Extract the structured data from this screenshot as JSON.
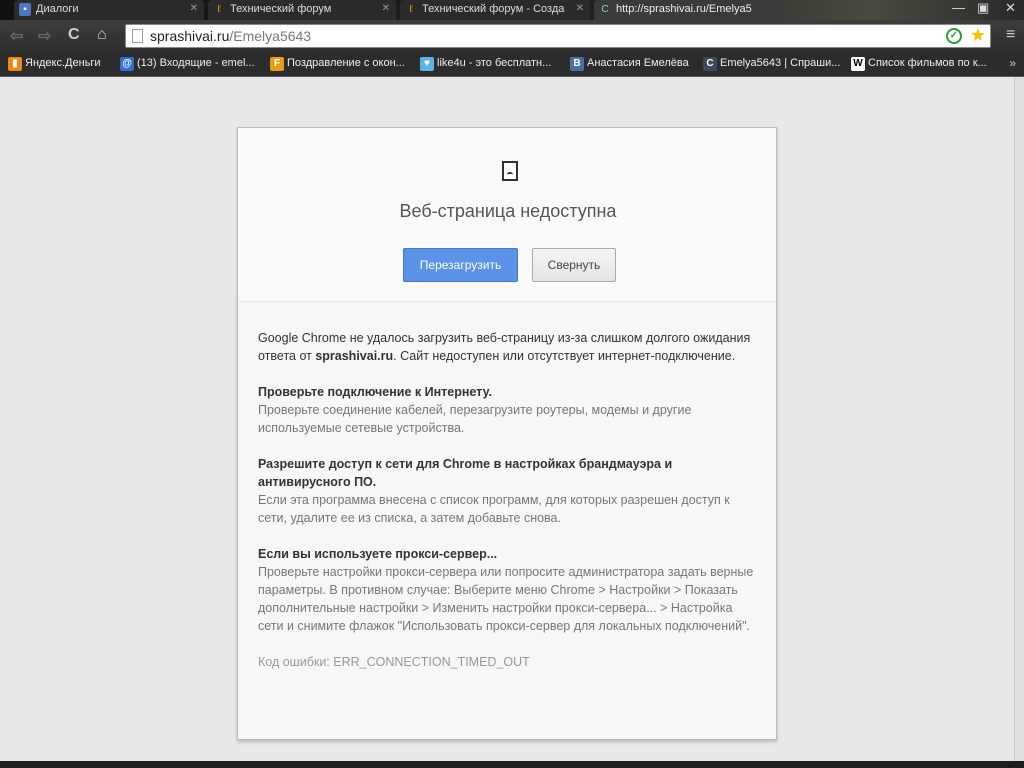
{
  "tabs": [
    {
      "title": "Диалоги",
      "icon": "dialog-icon",
      "active": false
    },
    {
      "title": "Технический форум",
      "icon": "forum-icon",
      "active": false
    },
    {
      "title": "Технический форум - Созда",
      "icon": "forum-icon",
      "active": false
    },
    {
      "title": "http://sprashivai.ru/Emelya5",
      "icon": "sprashivai-icon",
      "active": true
    }
  ],
  "omnibox": {
    "host": "sprashivai.ru",
    "path": "/Emelya5643"
  },
  "bookmarks": [
    {
      "label": "Яндекс.Деньги",
      "icon": "yandex-money-icon",
      "color": "#f0870f",
      "glyph": "▮"
    },
    {
      "label": "(13) Входящие - emel...",
      "icon": "mail-icon",
      "color": "#2a6ed6",
      "glyph": "@"
    },
    {
      "label": "Поздравление с окон...",
      "icon": "for-icon",
      "color": "#e89b14",
      "glyph": "F"
    },
    {
      "label": "like4u - это бесплатн...",
      "icon": "heart-icon",
      "color": "#5ab4e6",
      "glyph": "♥"
    },
    {
      "label": "Анастасия Емелёва",
      "icon": "vk-icon",
      "color": "#4a6fa5",
      "glyph": "B"
    },
    {
      "label": "Emelya5643 | Спраши...",
      "icon": "sprashivai-icon",
      "color": "#3a4a5a",
      "glyph": "C"
    },
    {
      "label": "Список фильмов по к...",
      "icon": "wikipedia-icon",
      "color": "#ffffff",
      "glyph": "W"
    }
  ],
  "error": {
    "title": "Веб-страница недоступна",
    "reload_label": "Перезагрузить",
    "hide_label": "Свернуть",
    "summary_pre": "Google Chrome не удалось загрузить веб-страницу из-за слишком долгого ожидания ответа от ",
    "summary_host": "sprashivai.ru",
    "summary_post": ". Сайт недоступен или отсутствует интернет-подключение.",
    "sections": [
      {
        "heading": "Проверьте подключение к Интернету.",
        "text": "Проверьте соединение кабелей, перезагрузите роутеры, модемы и другие используемые сетевые устройства."
      },
      {
        "heading": "Разрешите доступ к сети для Chrome в настройках брандмауэра и антивирусного ПО.",
        "text": "Если эта программа внесена с список программ, для которых разрешен доступ к сети, удалите ее из списка, а затем добавьте снова."
      },
      {
        "heading": "Если вы используете прокси-сервер...",
        "text": "Проверьте настройки прокси-сервера или попросите администратора задать верные параметры. В противном случае: Выберите меню Chrome > Настройки > Показать дополнительные настройки > Изменить настройки прокси-сервера... > Настройка сети и снимите флажок \"Использовать прокси-сервер для локальных подключений\"."
      }
    ],
    "error_code": "Код ошибки: ERR_CONNECTION_TIMED_OUT"
  }
}
